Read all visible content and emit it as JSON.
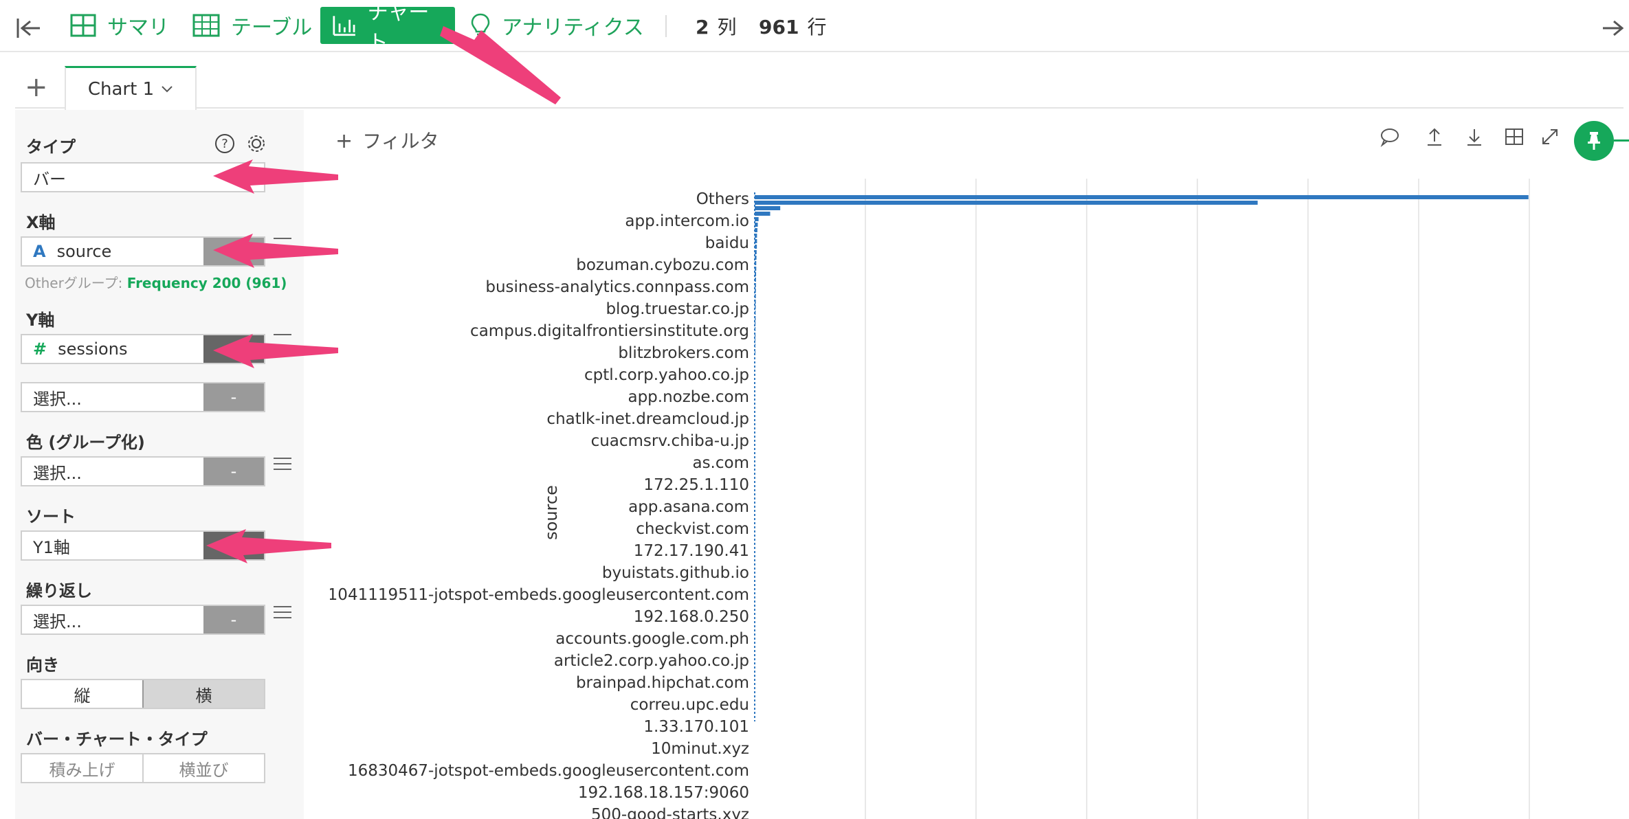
{
  "toolbar": {
    "summary_label": "サマリ",
    "table_label": "テーブル",
    "chart_label": "チャート",
    "analytics_label": "アナリティクス",
    "columns_count": "2",
    "columns_unit": "列",
    "rows_count": "961",
    "rows_unit": "行"
  },
  "tabs": {
    "add": "+",
    "active_label": "Chart 1",
    "active_chevron": "⌵"
  },
  "panel": {
    "type": {
      "label": "タイプ",
      "value": "バー"
    },
    "x_axis": {
      "label": "X軸",
      "value": "source",
      "type_icon": "A",
      "other_group_prefix": "Otherグループ: ",
      "other_group_value": "Frequency 200 (961)"
    },
    "y_axis": {
      "label": "Y軸",
      "value": "sessions",
      "type_icon": "#",
      "second_placeholder": "選択...",
      "second_btn": "-"
    },
    "color": {
      "label": "色 (グループ化)",
      "placeholder": "選択...",
      "btn": "-"
    },
    "sort": {
      "label": "ソート",
      "value": "Y1軸"
    },
    "repeat": {
      "label": "繰り返し",
      "placeholder": "選択...",
      "btn": "-"
    },
    "orientation": {
      "label": "向き",
      "vertical": "縦",
      "horizontal": "横"
    },
    "bar_type": {
      "label": "バー・チャート・タイプ",
      "stacked": "積み上げ",
      "side_by_side": "横並び"
    }
  },
  "main": {
    "filter_label": "フィルタ"
  },
  "colors": {
    "accent": "#16a85a",
    "bar": "#2f78c0",
    "highlight": "#ee3f7a"
  },
  "chart_data": {
    "type": "bar",
    "orientation": "horizontal",
    "ylabel": "source",
    "grid": true,
    "categories": [
      "Others",
      "app.intercom.io",
      "baidu",
      "bozuman.cybozu.com",
      "business-analytics.connpass.com",
      "blog.truestar.co.jp",
      "campus.digitalfrontiersinstitute.org",
      "blitzbrokers.com",
      "cptl.corp.yahoo.co.jp",
      "app.nozbe.com",
      "chatlk-inet.dreamcloud.jp",
      "cuacmsrv.chiba-u.jp",
      "as.com",
      "172.25.1.110",
      "app.asana.com",
      "checkvist.com",
      "172.17.190.41",
      "byuistats.github.io",
      "1041119511-jotspot-embeds.googleusercontent.com",
      "192.168.0.250",
      "accounts.google.com.ph",
      "article2.corp.yahoo.co.jp",
      "brainpad.hipchat.com",
      "correu.upc.edu",
      "1.33.170.101",
      "10minut.xyz",
      "16830467-jotspot-embeds.googleusercontent.com",
      "192.168.18.157:9060",
      "500-good-starts.xyz"
    ],
    "values": [
      100,
      65,
      3.3,
      2,
      0.5,
      0.4,
      0.35,
      0.3,
      0.3,
      0.28,
      0.25,
      0.23,
      0.2,
      0.2,
      0.18,
      0.17,
      0.16,
      0.15,
      0.15,
      0.14,
      0.13,
      0.12,
      0.12,
      0.1,
      0.1,
      0.1,
      0.08,
      0.08,
      0.08
    ],
    "xlim": [
      0,
      105
    ]
  }
}
